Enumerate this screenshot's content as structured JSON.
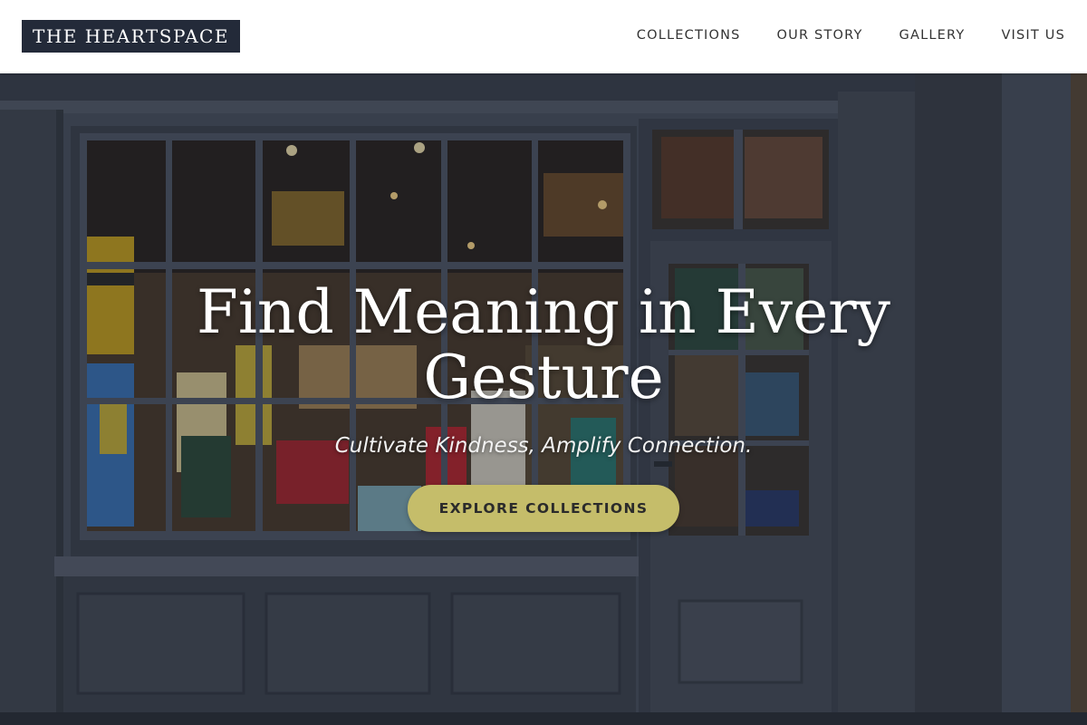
{
  "header": {
    "logo_text": "THE HEARTSPACE",
    "nav": [
      {
        "label": "COLLECTIONS"
      },
      {
        "label": "OUR STORY"
      },
      {
        "label": "GALLERY"
      },
      {
        "label": "VISIT US"
      }
    ]
  },
  "hero": {
    "title": "Find Meaning in Every Gesture",
    "subtitle": "Cultivate Kindness, Amplify Connection.",
    "cta_label": "EXPLORE COLLECTIONS",
    "background_image": "bookshop-storefront-photo"
  },
  "colors": {
    "header_bg": "#ffffff",
    "logo_bg": "#232a39",
    "nav_text": "#333333",
    "cta_bg": "#c5bd6a",
    "cta_text": "#2b2b2b",
    "hero_text": "#ffffff"
  }
}
